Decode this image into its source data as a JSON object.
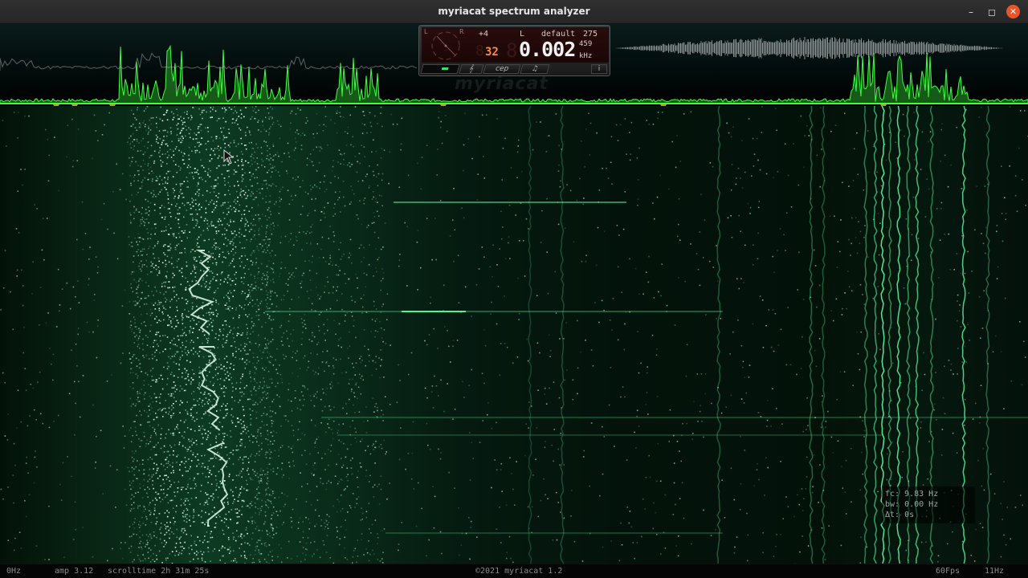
{
  "window": {
    "title": "myriacat spectrum analyzer",
    "buttons": {
      "minimize": "–",
      "maximize": "◻",
      "close": "✕"
    }
  },
  "panel": {
    "dial_left": "L",
    "dial_right": "R",
    "offset": "+4",
    "channel": "L",
    "preset": "default",
    "preset_number": "275",
    "ghost_digit": "8",
    "small_value": "32",
    "frequency": "0.002",
    "frequency_sub": "459",
    "frequency_unit": "kHz",
    "toolbar": {
      "voice_icon": "𝄞",
      "cep_label": "cep",
      "note_icon": "♫",
      "info_label": "i"
    },
    "meter_level": 0.6
  },
  "watermark": "myriacat",
  "readout": {
    "fc": "fc: 9.83 Hz",
    "bw": "bw: 0.00 Hz",
    "dt": "Δt: 0s"
  },
  "statusbar": {
    "freq_min": "0Hz",
    "amp": "amp 3.12",
    "scrolltime": "scrolltime 2h 31m 25s",
    "copyright": "©2021 myriacat 1.2",
    "fps": "60Fps",
    "freq_max": "11Hz"
  },
  "colors": {
    "spectrum": "#3dff3d",
    "waterfall": "#2fd58a",
    "marker": "#c89a2a",
    "close_button": "#e9542a",
    "lcd_digit": "#ff8a3a"
  }
}
